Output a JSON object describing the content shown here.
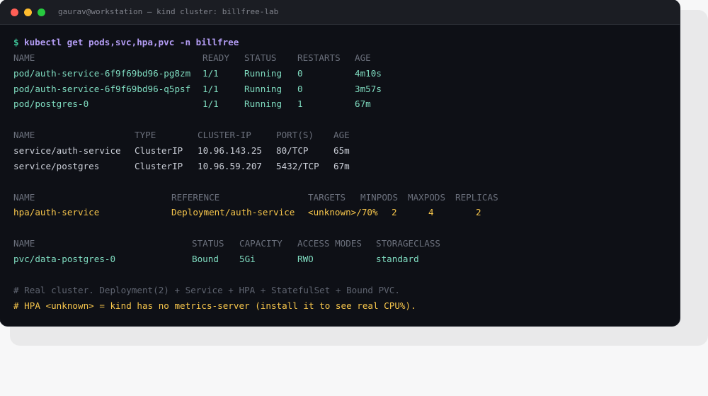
{
  "window": {
    "title": "gaurav@workstation — kind cluster: billfree-lab"
  },
  "command": {
    "prompt": "$",
    "text": "kubectl get pods,svc,hpa,pvc -n billfree"
  },
  "pods": {
    "headers": [
      "NAME",
      "READY",
      "STATUS",
      "RESTARTS",
      "AGE"
    ],
    "rows": [
      [
        "pod/auth-service-6f9f69bd96-pg8zm",
        "1/1",
        "Running",
        "0",
        "4m10s"
      ],
      [
        "pod/auth-service-6f9f69bd96-q5psf",
        "1/1",
        "Running",
        "0",
        "3m57s"
      ],
      [
        "pod/postgres-0",
        "1/1",
        "Running",
        "1",
        "67m"
      ]
    ]
  },
  "services": {
    "headers": [
      "NAME",
      "TYPE",
      "CLUSTER-IP",
      "PORT(S)",
      "AGE"
    ],
    "rows": [
      [
        "service/auth-service",
        "ClusterIP",
        "10.96.143.25",
        "80/TCP",
        "65m"
      ],
      [
        "service/postgres",
        "ClusterIP",
        "10.96.59.207",
        "5432/TCP",
        "67m"
      ]
    ]
  },
  "hpa": {
    "headers": [
      "NAME",
      "REFERENCE",
      "TARGETS",
      "MINPODS",
      "MAXPODS",
      "REPLICAS"
    ],
    "rows": [
      [
        "hpa/auth-service",
        "Deployment/auth-service",
        "<unknown>/70%",
        "2",
        "4",
        "2"
      ]
    ]
  },
  "pvc": {
    "headers": [
      "NAME",
      "STATUS",
      "CAPACITY",
      "ACCESS MODES",
      "STORAGECLASS"
    ],
    "rows": [
      [
        "pvc/data-postgres-0",
        "Bound",
        "5Gi",
        "RWO",
        "standard"
      ]
    ]
  },
  "comments": [
    "# Real cluster. Deployment(2) + Service + HPA + StatefulSet + Bound PVC.",
    "# HPA <unknown> = kind has no metrics-server (install it to see real CPU%)."
  ],
  "colors": {
    "background": "#0e1016",
    "prompt": "#3ec79a",
    "command": "#b39cf4",
    "header": "#6b707c",
    "value": "#7fdcc0",
    "warning": "#f6c54b",
    "comment": "#5f6470"
  }
}
